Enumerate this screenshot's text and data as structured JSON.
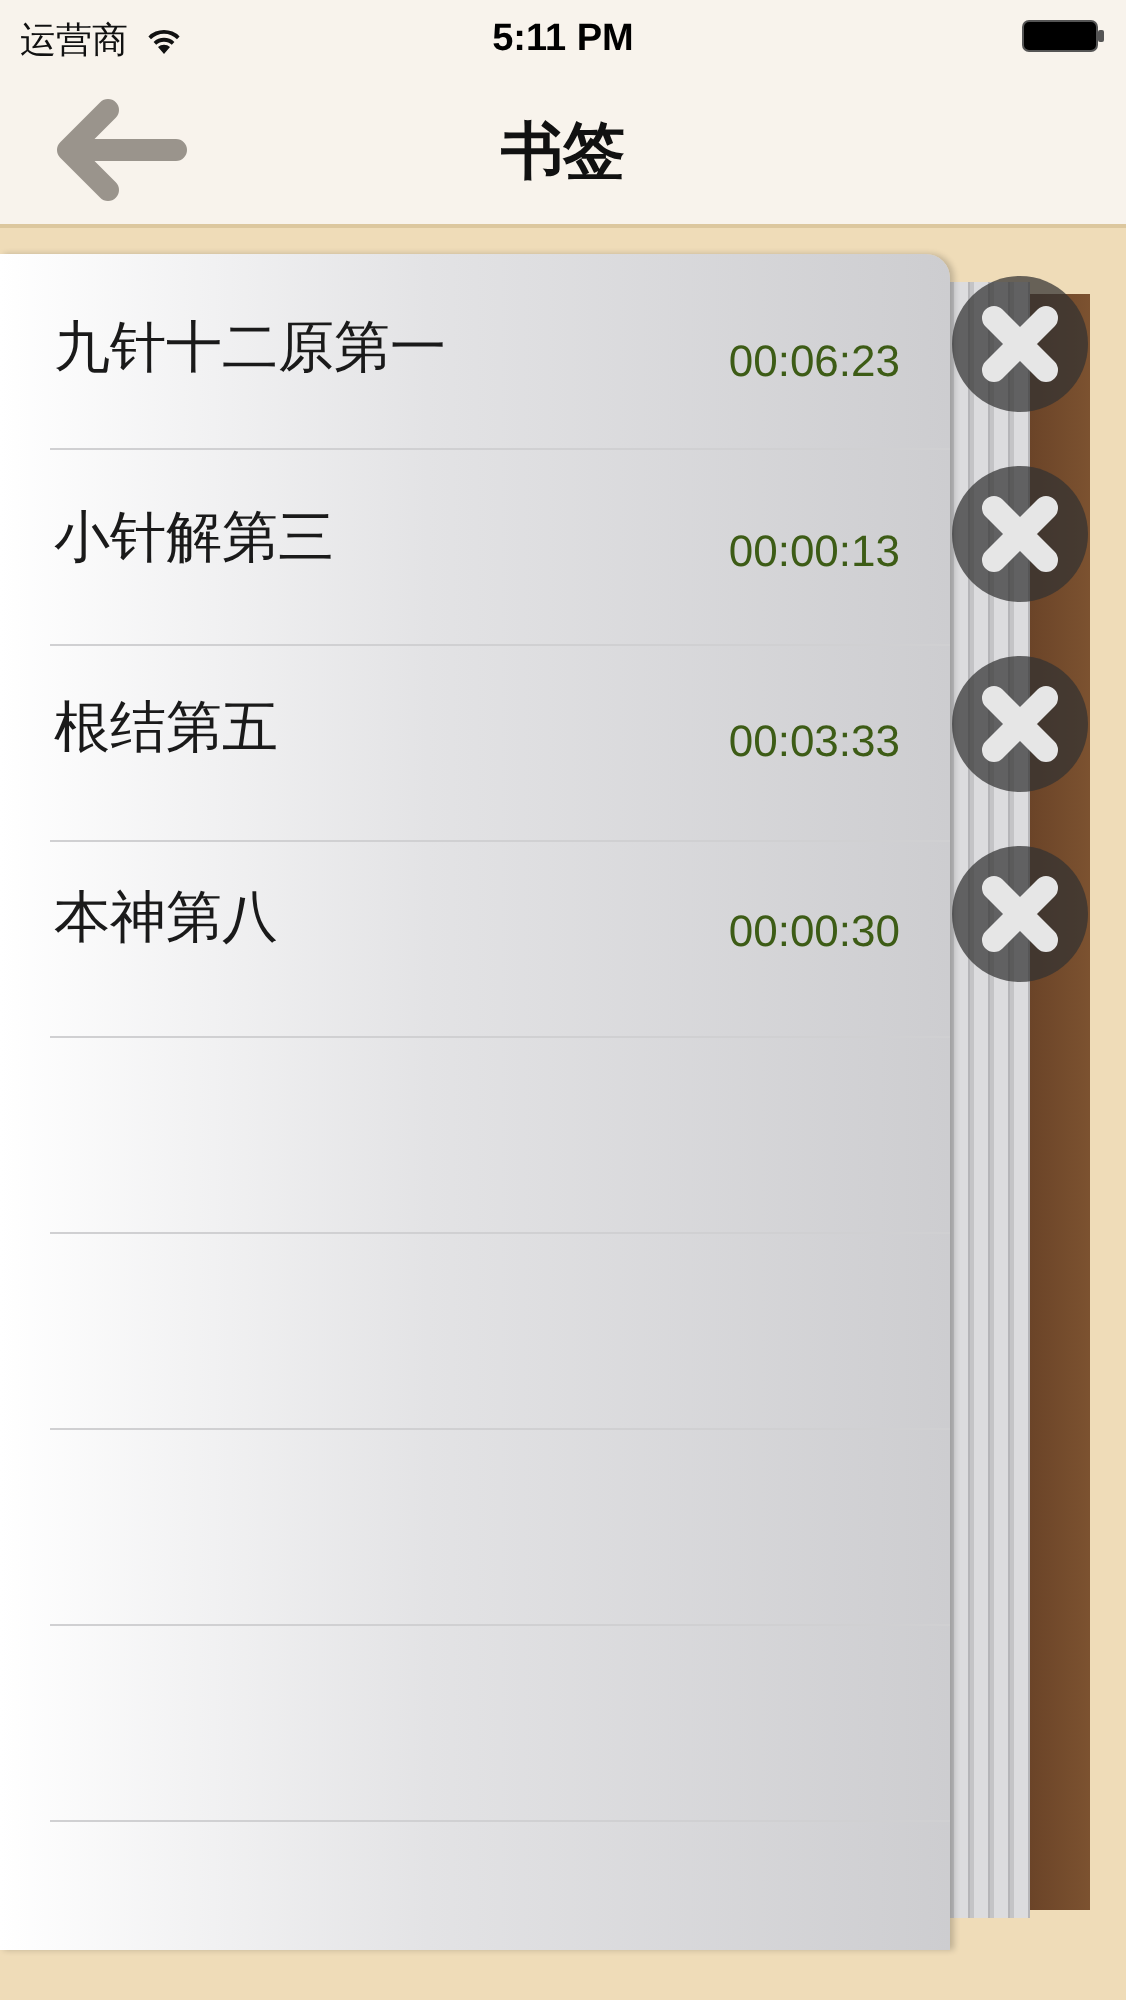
{
  "status_bar": {
    "carrier": "运营商",
    "time": "5:11 PM"
  },
  "nav_bar": {
    "title": "书签"
  },
  "bookmarks": [
    {
      "title": "九针十二原第一",
      "time": "00:06:23"
    },
    {
      "title": "小针解第三",
      "time": "00:00:13"
    },
    {
      "title": "根结第五",
      "time": "00:03:33"
    },
    {
      "title": "本神第八",
      "time": "00:00:30"
    }
  ]
}
